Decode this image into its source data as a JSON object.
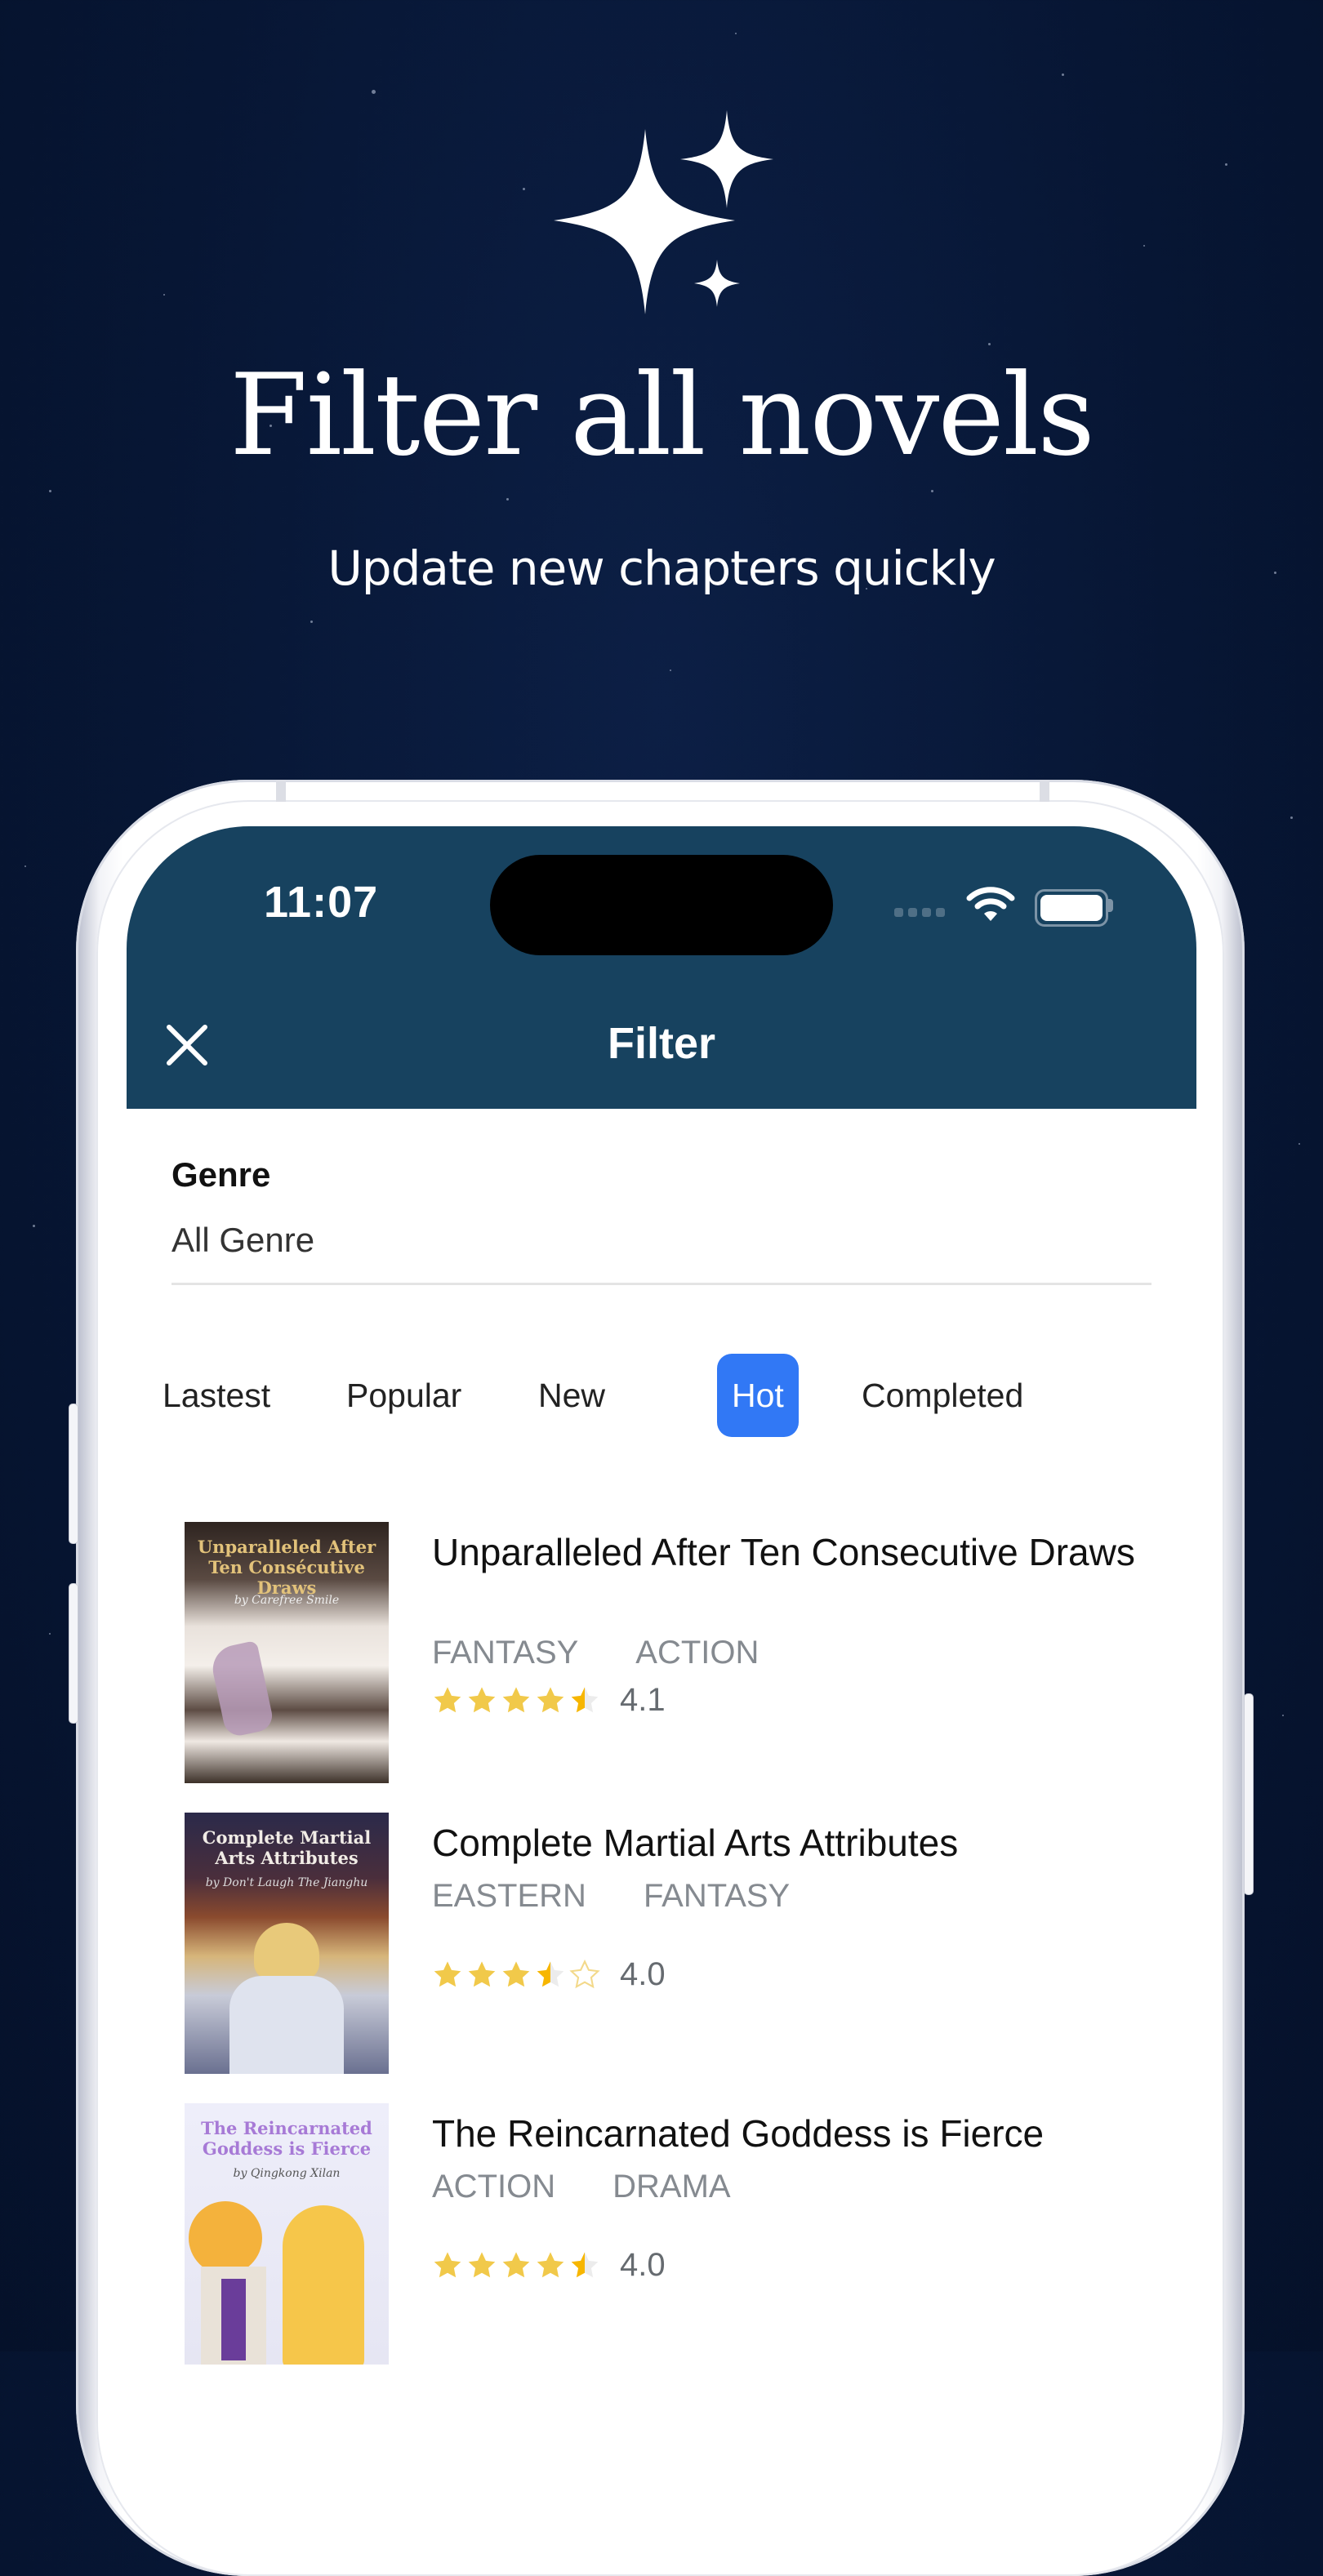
{
  "hero": {
    "icon": "sparkles-icon",
    "title": "Filter all novels",
    "subtitle": "Update new chapters quickly"
  },
  "status_bar": {
    "time": "11:07",
    "icons": [
      "cellular-signal-icon",
      "wifi-icon",
      "battery-icon"
    ]
  },
  "nav": {
    "close_icon": "close-icon",
    "title": "Filter"
  },
  "genre": {
    "label": "Genre",
    "value": "All Genre"
  },
  "sort_tabs": {
    "items": [
      {
        "label": "Lastest",
        "active": false
      },
      {
        "label": "Popular",
        "active": false
      },
      {
        "label": "New",
        "active": false
      },
      {
        "label": "Hot",
        "active": true
      },
      {
        "label": "Completed",
        "active": false
      }
    ]
  },
  "colors": {
    "background": "#071634",
    "header": "#17425f",
    "accent": "#3178f5",
    "star": "#f1c94a",
    "star_half": "#f7b600",
    "tag_text": "#858a90"
  },
  "books": [
    {
      "title": "Unparalleled After Ten Consecutive Draws",
      "cover_title": "Unparalleled After Ten Consécutive Draws",
      "cover_author": "by Carefree Smile",
      "tags": [
        "FANTASY",
        "ACTION"
      ],
      "stars_filled": 4.5,
      "rating": "4.1"
    },
    {
      "title": "Complete Martial Arts Attributes",
      "cover_title": "Complete Martial Arts Attributes",
      "cover_author": "by Don't Laugh The Jianghu",
      "tags": [
        "EASTERN",
        "FANTASY"
      ],
      "stars_filled": 3.5,
      "rating": "4.0"
    },
    {
      "title": "The Reincarnated Goddess is Fierce",
      "cover_title": "The Reincarnated Goddess is Fierce",
      "cover_author": "by Qingkong Xilan",
      "tags": [
        "ACTION",
        "DRAMA"
      ],
      "stars_filled": 4.5,
      "rating": "4.0"
    }
  ]
}
